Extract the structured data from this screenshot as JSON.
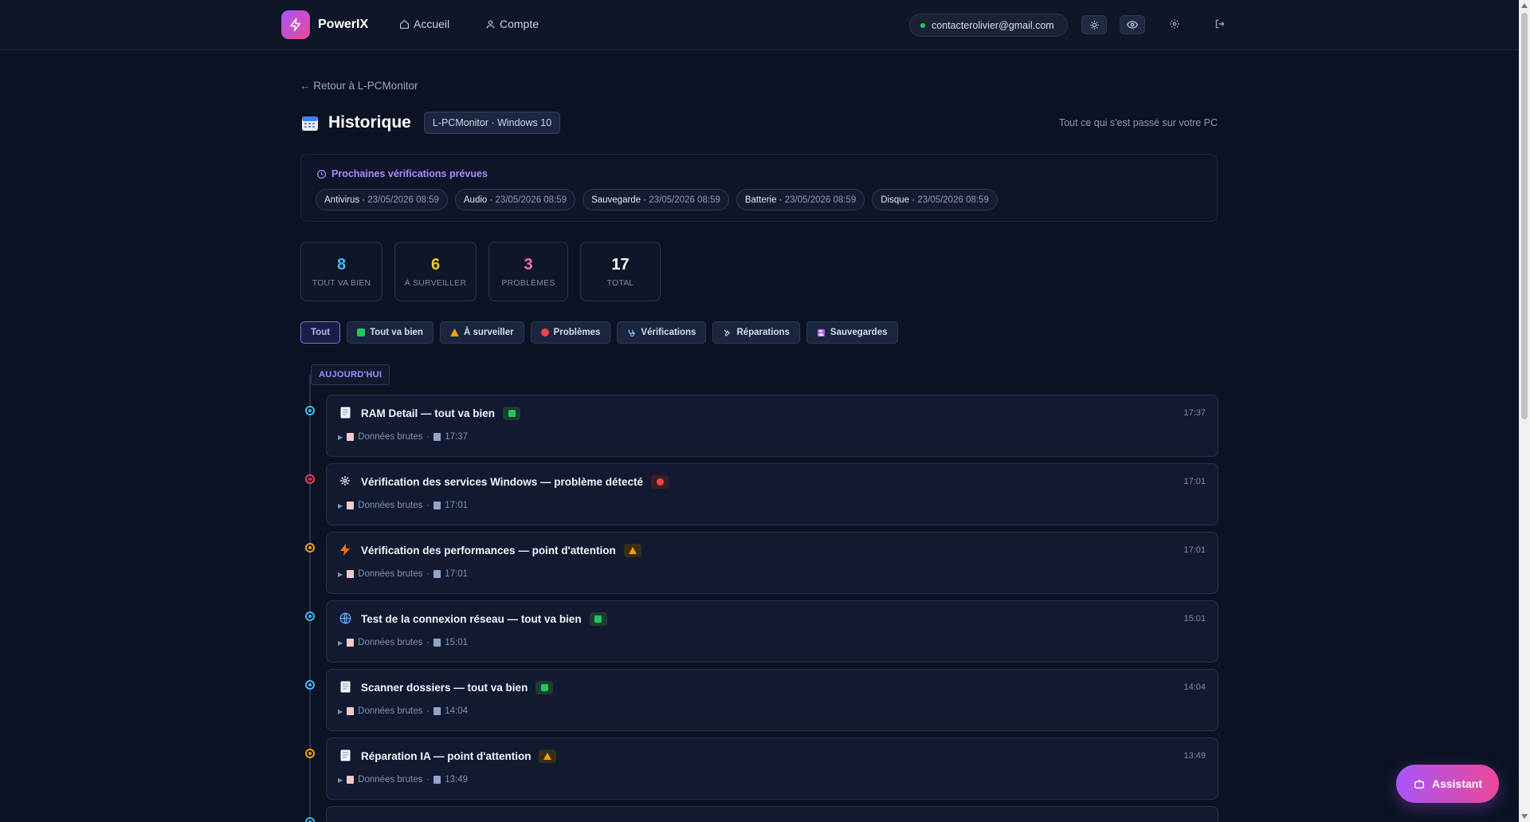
{
  "header": {
    "brand": "PowerIX",
    "nav": [
      {
        "label": "Accueil",
        "icon": "home-icon"
      },
      {
        "label": "Compte",
        "icon": "user-icon"
      }
    ],
    "email": "contacterolivier@gmail.com",
    "status_color": "#22c55e"
  },
  "page": {
    "back_link": "← Retour à L-PCMonitor",
    "title": "Historique",
    "device_badge": "L-PCMonitor · Windows 10",
    "subtitle": "Tout ce qui s'est passé sur votre PC"
  },
  "planned": {
    "title": "Prochaines vérifications prévues",
    "chips": [
      {
        "name": "Antivirus",
        "date": "23/05/2026 08:59"
      },
      {
        "name": "Audio",
        "date": "23/05/2026 08:59"
      },
      {
        "name": "Sauvegarde",
        "date": "23/05/2026 08:59"
      },
      {
        "name": "Batterie",
        "date": "23/05/2026 08:59"
      },
      {
        "name": "Disque",
        "date": "23/05/2026 08:59"
      }
    ]
  },
  "stats": [
    {
      "value": "8",
      "label": "TOUT VA BIEN",
      "color": "#38bdf8"
    },
    {
      "value": "6",
      "label": "À SURVEILLER",
      "color": "#facc15"
    },
    {
      "value": "3",
      "label": "PROBLÈMES",
      "color": "#f472b6"
    },
    {
      "value": "17",
      "label": "TOTAL",
      "color": "#ffffff"
    }
  ],
  "filters": [
    {
      "label": "Tout",
      "icon": "",
      "active": true
    },
    {
      "label": "Tout va bien",
      "icon": "check-icon"
    },
    {
      "label": "À surveiller",
      "icon": "warning-icon"
    },
    {
      "label": "Problèmes",
      "icon": "red-dot-icon"
    },
    {
      "label": "Vérifications",
      "icon": "stethoscope-icon"
    },
    {
      "label": "Réparations",
      "icon": "tools-icon"
    },
    {
      "label": "Sauvegardes",
      "icon": "floppy-icon"
    }
  ],
  "day_label": "AUJOURD'HUI",
  "events": [
    {
      "title": "RAM Detail — tout va bien",
      "icon": "memo-icon",
      "status": "ok",
      "time": "17:37",
      "raw": "Données brutes",
      "raw_time": "17:37"
    },
    {
      "title": "Vérification des services Windows — problème détecté",
      "icon": "gear-icon",
      "status": "problem",
      "time": "17:01",
      "raw": "Données brutes",
      "raw_time": "17:01"
    },
    {
      "title": "Vérification des performances — point d'attention",
      "icon": "lightning-icon",
      "status": "warn",
      "time": "17:01",
      "raw": "Données brutes",
      "raw_time": "17:01"
    },
    {
      "title": "Test de la connexion réseau — tout va bien",
      "icon": "globe-icon",
      "status": "ok",
      "time": "15:01",
      "raw": "Données brutes",
      "raw_time": "15:01"
    },
    {
      "title": "Scanner dossiers — tout va bien",
      "icon": "memo-icon",
      "status": "ok",
      "time": "14:04",
      "raw": "Données brutes",
      "raw_time": "14:04"
    },
    {
      "title": "Réparation IA — point d'attention",
      "icon": "memo-icon",
      "status": "warn",
      "time": "13:49",
      "raw": "Données brutes",
      "raw_time": "13:49"
    }
  ],
  "assistant": {
    "label": "Assistant",
    "icon": "robot-icon"
  },
  "colors": {
    "ok": "#22c55e",
    "warn": "#f59e0b",
    "problem": "#ef4444",
    "accent": "#a855f7"
  }
}
